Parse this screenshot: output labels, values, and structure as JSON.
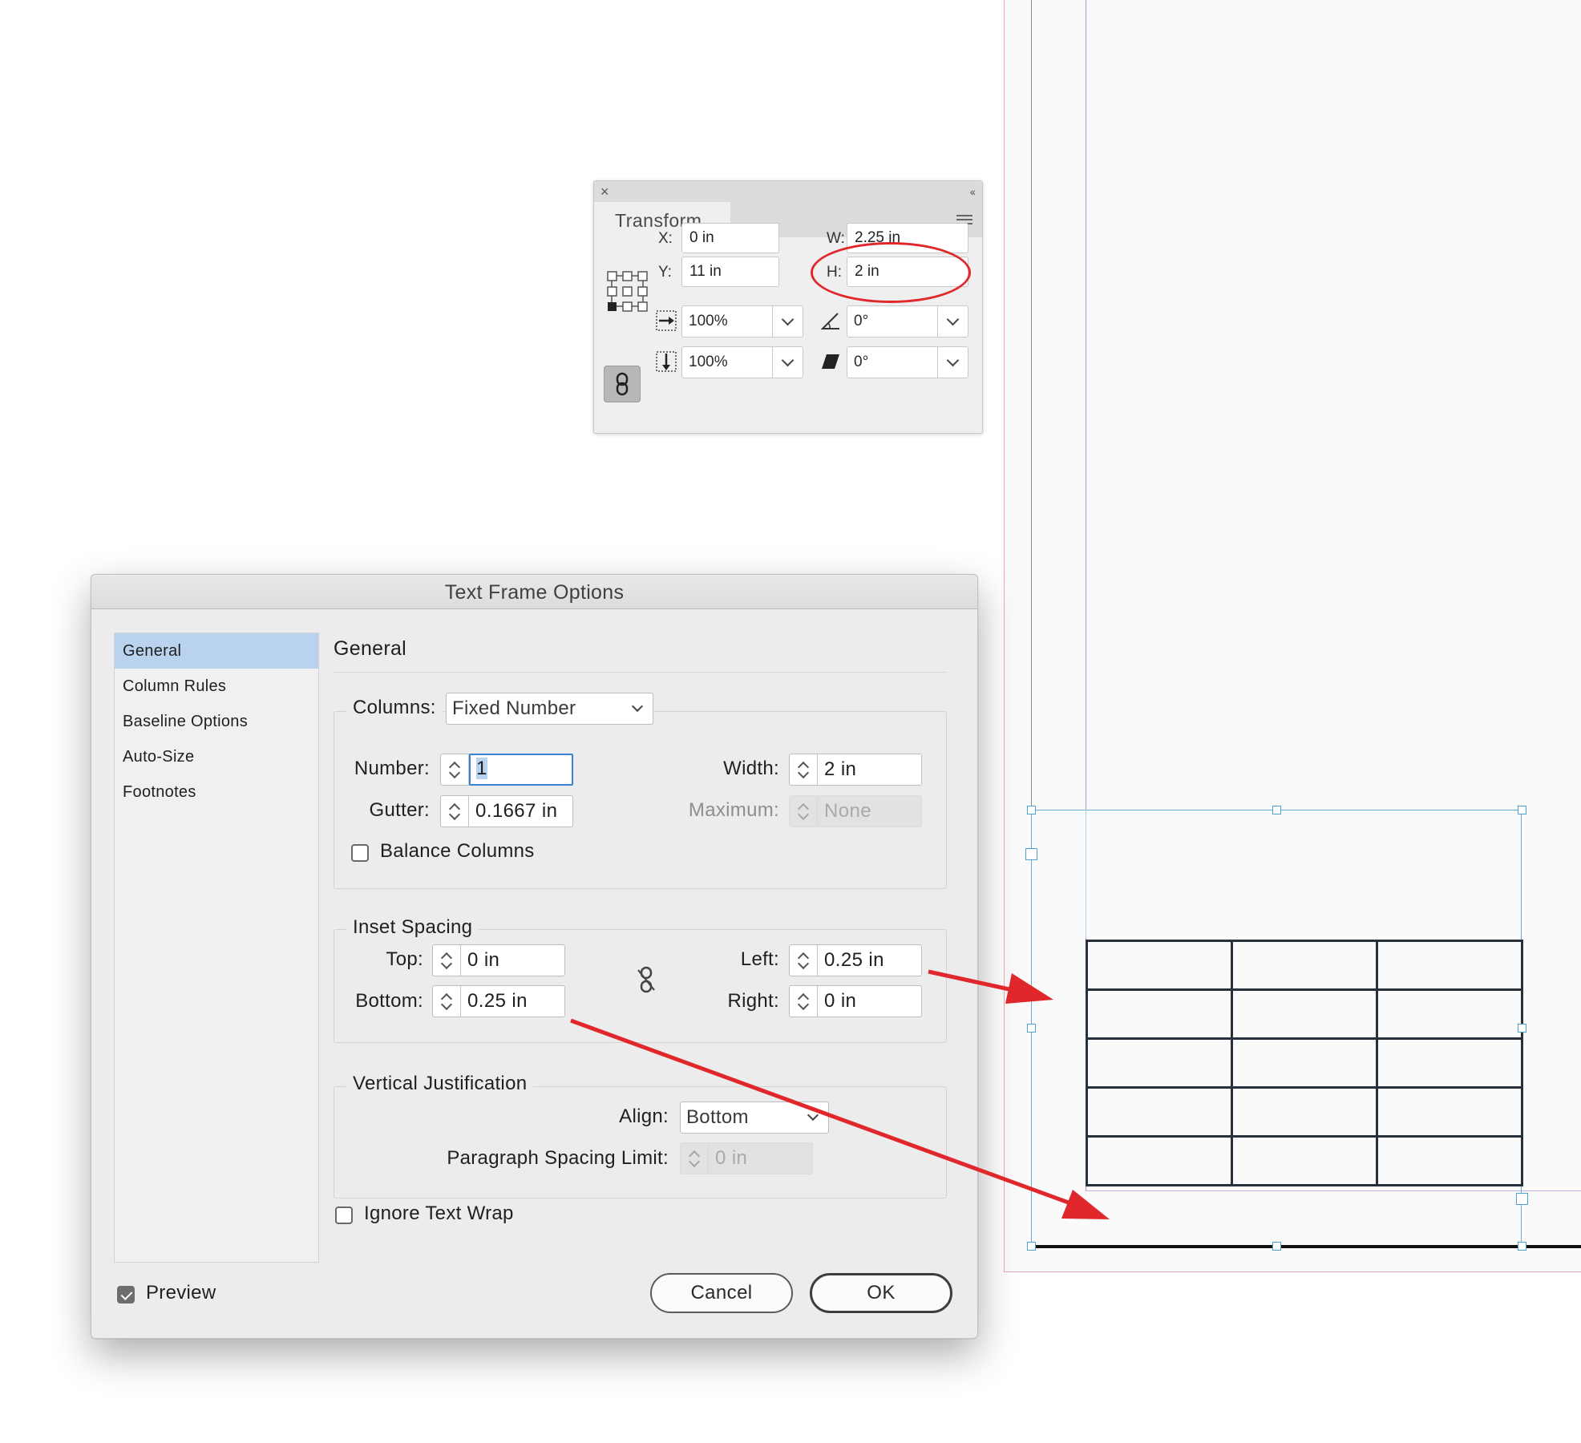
{
  "transform_panel": {
    "tab_label": "Transform",
    "x_label": "X:",
    "x_value": "0 in",
    "y_label": "Y:",
    "y_value": "11 in",
    "w_label": "W:",
    "w_value": "2.25 in",
    "h_label": "H:",
    "h_value": "2 in",
    "scale_x_value": "100%",
    "scale_y_value": "100%",
    "rotation_value": "0°",
    "shear_value": "0°"
  },
  "dialog": {
    "title": "Text Frame Options",
    "sidebar": [
      {
        "label": "General",
        "selected": true
      },
      {
        "label": "Column Rules",
        "selected": false
      },
      {
        "label": "Baseline Options",
        "selected": false
      },
      {
        "label": "Auto-Size",
        "selected": false
      },
      {
        "label": "Footnotes",
        "selected": false
      }
    ],
    "section_title": "General",
    "columns": {
      "label": "Columns:",
      "mode": "Fixed Number",
      "number_label": "Number:",
      "number_value": "1",
      "gutter_label": "Gutter:",
      "gutter_value": "0.1667 in",
      "width_label": "Width:",
      "width_value": "2 in",
      "maximum_label": "Maximum:",
      "maximum_value": "None",
      "balance_label": "Balance Columns",
      "balance_checked": false
    },
    "inset": {
      "label": "Inset Spacing",
      "top_label": "Top:",
      "top_value": "0 in",
      "bottom_label": "Bottom:",
      "bottom_value": "0.25 in",
      "left_label": "Left:",
      "left_value": "0.25 in",
      "right_label": "Right:",
      "right_value": "0 in"
    },
    "vertical_justification": {
      "label": "Vertical Justification",
      "align_label": "Align:",
      "align_value": "Bottom",
      "para_limit_label": "Paragraph Spacing Limit:",
      "para_limit_value": "0 in"
    },
    "ignore_wrap_label": "Ignore Text Wrap",
    "ignore_wrap_checked": false,
    "preview_label": "Preview",
    "preview_checked": true,
    "cancel_label": "Cancel",
    "ok_label": "OK"
  },
  "colors": {
    "annotation_red": "#e0282c",
    "frame_blue": "#5fb0d6",
    "selection_blue": "#b9d2ee",
    "margin_pink": "#f0a6b8",
    "margin_purple": "#b98ed8"
  }
}
